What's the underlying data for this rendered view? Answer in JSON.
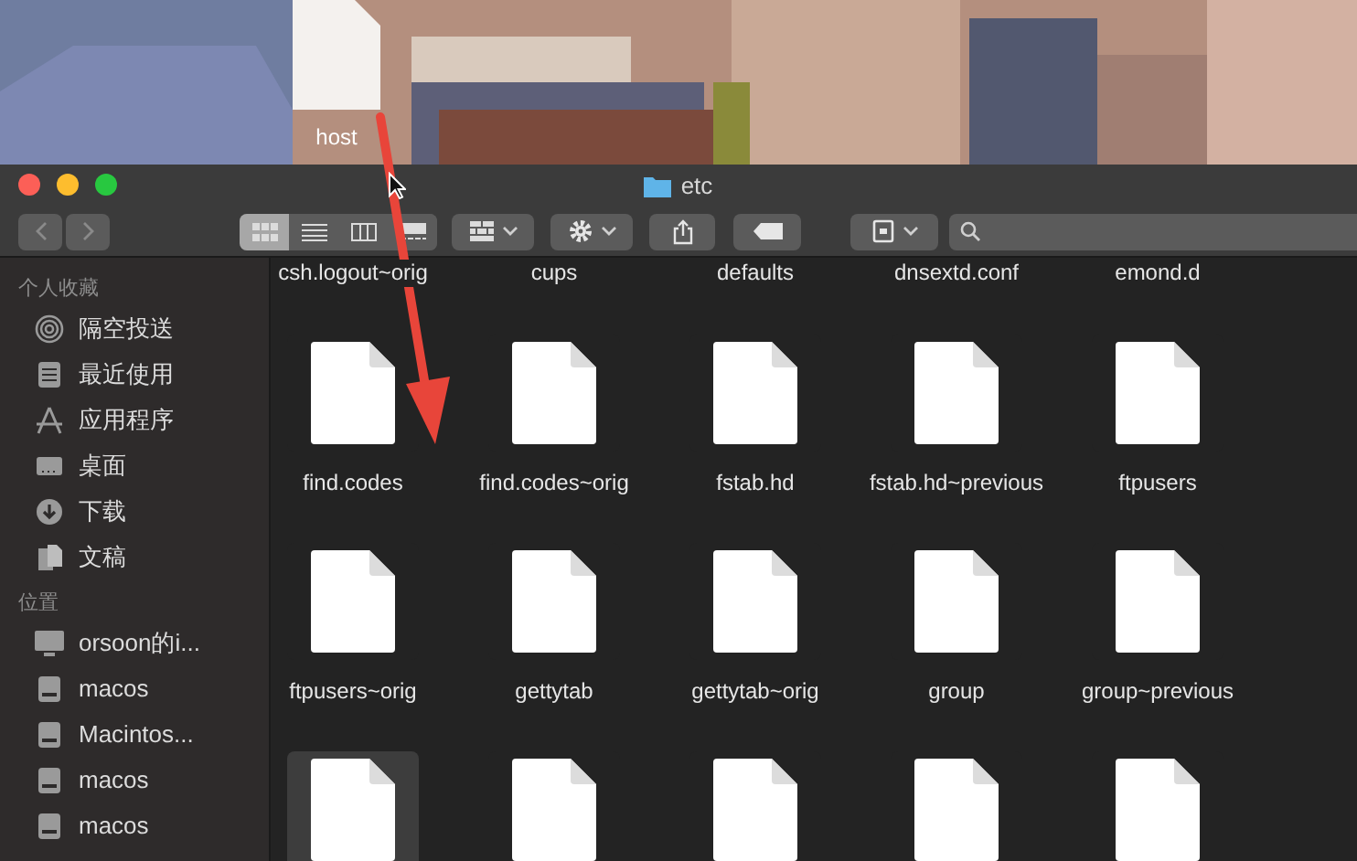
{
  "desktop": {
    "dragged_file": {
      "label": "host"
    }
  },
  "window": {
    "title": "etc"
  },
  "toolbar": {
    "view_modes": [
      {
        "kind": "icons",
        "selected": true
      },
      {
        "kind": "list",
        "selected": false
      },
      {
        "kind": "columns",
        "selected": false
      },
      {
        "kind": "gallery",
        "selected": false
      }
    ]
  },
  "sidebar": {
    "sections": [
      {
        "title": "个人收藏",
        "items": [
          {
            "label": "隔空投送",
            "kind": "airdrop"
          },
          {
            "label": "最近使用",
            "kind": "recents"
          },
          {
            "label": "应用程序",
            "kind": "apps"
          },
          {
            "label": "桌面",
            "kind": "desktop"
          },
          {
            "label": "下载",
            "kind": "downloads"
          },
          {
            "label": "文稿",
            "kind": "documents"
          }
        ]
      },
      {
        "title": "位置",
        "items": [
          {
            "label": "orsoon的i...",
            "kind": "computer"
          },
          {
            "label": "macos",
            "kind": "disk"
          },
          {
            "label": "Macintos...",
            "kind": "disk"
          },
          {
            "label": "macos",
            "kind": "disk"
          },
          {
            "label": "macos",
            "kind": "disk"
          }
        ]
      }
    ]
  },
  "file_rows": [
    {
      "kind": "label_only",
      "files": [
        {
          "name": "csh.logout~orig"
        },
        {
          "name": "cups"
        },
        {
          "name": "defaults"
        },
        {
          "name": "dnsextd.conf"
        },
        {
          "name": "emond.d"
        }
      ]
    },
    {
      "kind": "full",
      "files": [
        {
          "name": "find.codes",
          "selected": false
        },
        {
          "name": "find.codes~orig",
          "selected": false
        },
        {
          "name": "fstab.hd",
          "selected": false
        },
        {
          "name": "fstab.hd~previous",
          "selected": false
        },
        {
          "name": "ftpusers",
          "selected": false
        }
      ]
    },
    {
      "kind": "full",
      "files": [
        {
          "name": "ftpusers~orig",
          "selected": false
        },
        {
          "name": "gettytab",
          "selected": false
        },
        {
          "name": "gettytab~orig",
          "selected": false
        },
        {
          "name": "group",
          "selected": false
        },
        {
          "name": "group~previous",
          "selected": false
        }
      ]
    },
    {
      "kind": "icon_only",
      "files": [
        {
          "selected": true
        },
        {
          "selected": false
        },
        {
          "selected": false
        },
        {
          "selected": false
        },
        {
          "selected": false
        }
      ]
    }
  ]
}
